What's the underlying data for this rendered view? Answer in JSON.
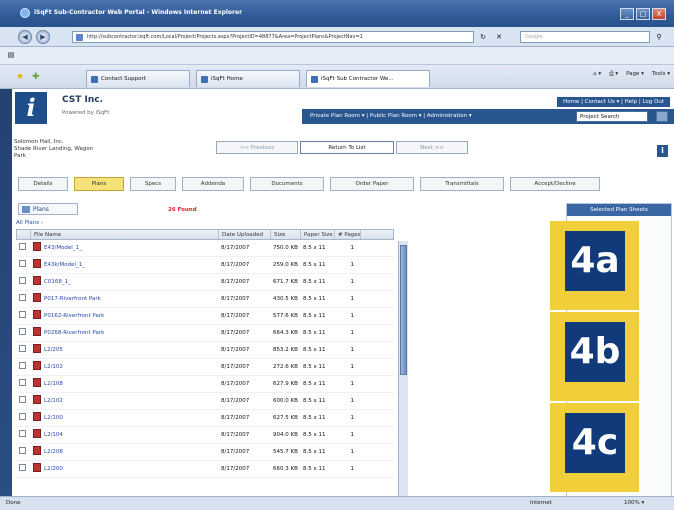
{
  "window": {
    "title": "iSqFt Sub-Contractor Web Portal - Windows Internet Explorer",
    "btn_min": "_",
    "btn_max": "□",
    "btn_close": "X"
  },
  "addressbar": {
    "url": "http://subcontractor.isqft.com/Local/Project/Projects.aspx?ProjectID=48877&Area=ProjectPlans&ProjectNav=1",
    "search_placeholder": "Google",
    "back_icon": "arrow-left-icon",
    "forward_icon": "arrow-right-icon"
  },
  "browser_tabs": [
    {
      "label": "Contact Support"
    },
    {
      "label": "iSqFt Home"
    },
    {
      "label": "iSqFt Sub Contractor We..."
    }
  ],
  "browser_tools": {
    "page": "Page ▾",
    "tools": "Tools ▾"
  },
  "site": {
    "company": "CST Inc.",
    "powered_by": "Powered by iSqFt",
    "top_links": "Home  |  Contact Us ▾  |  Help  |  Log Out",
    "main_nav": "Private Plan Room ▾   |   Public Plan Room ▾   |   Administration ▾",
    "project_search": "Project Search"
  },
  "project": {
    "address_line1": "Solomon Hall, Inc.",
    "address_line2": "Shade River Landing, Wagon",
    "address_line3": "Park",
    "prev_label": "<< Previous",
    "return_label": "Return To List",
    "next_label": "Next >>"
  },
  "project_tabs": [
    "Details",
    "Plans",
    "Specs",
    "Addenda",
    "Documents",
    "Order Paper",
    "Transmittals",
    "Accept/Decline"
  ],
  "plans": {
    "box_label": "Plans",
    "found_text": "26 Found",
    "all_plans": "All Plans ›"
  },
  "table": {
    "headers": [
      "",
      "File Name",
      "Date Uploaded",
      "Size",
      "Paper Size",
      "# Pages"
    ],
    "rows": [
      {
        "name": "E43/Model_1_",
        "date": "8/17/2007",
        "size": "750.0 KB",
        "paper": "8.5 x 11",
        "pages": "1"
      },
      {
        "name": "E43k/Model_1_",
        "date": "8/17/2007",
        "size": "259.0 KB",
        "paper": "8.5 x 11",
        "pages": "1"
      },
      {
        "name": "C0168_1_",
        "date": "8/17/2007",
        "size": "671.7 KB",
        "paper": "8.5 x 11",
        "pages": "1"
      },
      {
        "name": "P017-Riverfront Park",
        "date": "8/17/2007",
        "size": "430.5 KB",
        "paper": "8.5 x 11",
        "pages": "1"
      },
      {
        "name": "P0162-Riverfront Park",
        "date": "8/17/2007",
        "size": "577.6 KB",
        "paper": "8.5 x 11",
        "pages": "1"
      },
      {
        "name": "P0268-Riverfront Park",
        "date": "8/17/2007",
        "size": "664.3 KB",
        "paper": "8.5 x 11",
        "pages": "1"
      },
      {
        "name": "L2/205",
        "date": "8/17/2007",
        "size": "853.2 KB",
        "paper": "8.5 x 11",
        "pages": "1"
      },
      {
        "name": "L2/102",
        "date": "8/17/2007",
        "size": "272.6 KB",
        "paper": "8.5 x 11",
        "pages": "1"
      },
      {
        "name": "L2/108",
        "date": "8/17/2007",
        "size": "627.9 KB",
        "paper": "8.5 x 11",
        "pages": "1"
      },
      {
        "name": "L2/102",
        "date": "8/17/2007",
        "size": "600.0 KB",
        "paper": "8.5 x 11",
        "pages": "1"
      },
      {
        "name": "L2/100",
        "date": "8/17/2007",
        "size": "627.5 KB",
        "paper": "8.5 x 11",
        "pages": "1"
      },
      {
        "name": "L2/104",
        "date": "8/17/2007",
        "size": "904.0 KB",
        "paper": "8.5 x 11",
        "pages": "1"
      },
      {
        "name": "L2/208",
        "date": "8/17/2007",
        "size": "545.7 KB",
        "paper": "8.5 x 11",
        "pages": "1"
      },
      {
        "name": "L2/200",
        "date": "8/17/2007",
        "size": "660.3 KB",
        "paper": "8.5 x 11",
        "pages": "1"
      }
    ]
  },
  "right_panel": {
    "header": "Selected Plan Sheets"
  },
  "callouts": [
    "4a",
    "4b",
    "4c"
  ],
  "statusbar": {
    "left": "Done",
    "zone": "Internet",
    "zoom": "100% ▾"
  },
  "colors": {
    "brand": "#2a5690",
    "callout_yellow": "#f1cf3a",
    "callout_blue": "#103a7a",
    "found_red": "#dd2222"
  }
}
